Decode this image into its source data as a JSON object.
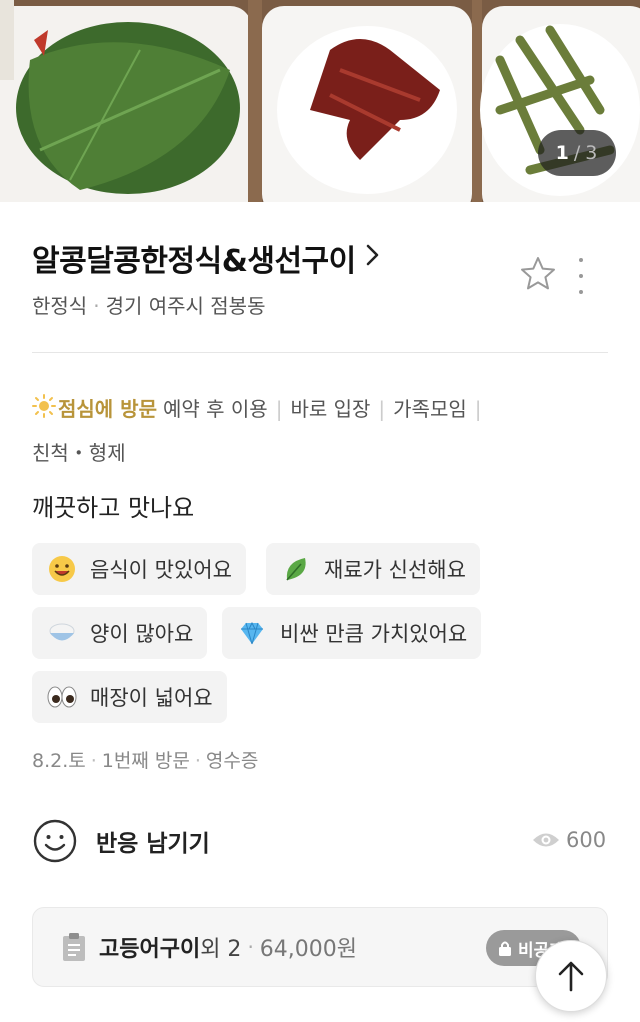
{
  "photos": {
    "current": "1",
    "separator": "/",
    "total": "3"
  },
  "restaurant": {
    "name": "알콩달콩한정식&생선구이",
    "category": "한정식",
    "location": "경기 여주시 점봉동"
  },
  "visit": {
    "time": "점심에 방문",
    "tags": [
      "예약 후 이용",
      "바로 입장",
      "가족모임",
      "친척・형제"
    ]
  },
  "review_text": "깨끗하고 맛나요",
  "keywords": [
    {
      "icon": "smiley-emoji",
      "label": "음식이 맛있어요"
    },
    {
      "icon": "leaf-emoji",
      "label": "재료가 신선해요"
    },
    {
      "icon": "rice-bowl-emoji",
      "label": "양이 많아요"
    },
    {
      "icon": "gem-emoji",
      "label": "비싼 만큼 가치있어요"
    },
    {
      "icon": "eyes-emoji",
      "label": "매장이 넓어요"
    }
  ],
  "meta": {
    "date": "8.2.토",
    "visit_count": "1번째 방문",
    "proof": "영수증"
  },
  "reaction": {
    "label": "반응 남기기",
    "views": "600"
  },
  "order": {
    "item": "고등어구이",
    "extra": "외 2",
    "price": "64,000원",
    "badge": "비공개"
  },
  "colors": {
    "accent_gold": "#b8943a",
    "chip_bg": "#f3f3f3",
    "badge_gray": "#9a9a9a"
  }
}
